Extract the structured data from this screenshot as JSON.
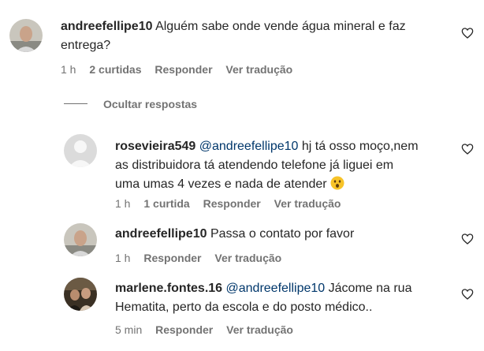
{
  "comments": [
    {
      "username": "andreefellipe10",
      "text_line1": "Alguém sabe onde vende água mineral e faz",
      "text_line2": "entrega?",
      "time": "1 h",
      "likes": "2 curtidas",
      "reply": "Responder",
      "translate": "Ver tradução"
    }
  ],
  "thread": {
    "hide_label": "Ocultar respostas"
  },
  "replies": [
    {
      "username": "rosevieira549",
      "mention": "@andreefellipe10",
      "text_line1": "hj tá osso moço,nem",
      "text_line2": "as distribuidora tá atendendo telefone já liguei em",
      "text_line3": "uma umas 4 vezes e nada de atender",
      "emoji": "hushed-face",
      "time": "1 h",
      "likes": "1 curtida",
      "reply": "Responder",
      "translate": "Ver tradução"
    },
    {
      "username": "andreefellipe10",
      "text_line1": "Passa o contato por favor",
      "time": "1 h",
      "reply": "Responder",
      "translate": "Ver tradução"
    },
    {
      "username": "marlene.fontes.16",
      "mention": "@andreefellipe10",
      "text_line1": "Jácome na rua",
      "text_line2": "Hematita, perto da escola e do posto médico..",
      "time": "5 min",
      "reply": "Responder",
      "translate": "Ver tradução"
    }
  ],
  "colors": {
    "text": "#262626",
    "meta": "#737373",
    "mention": "#00376b"
  }
}
